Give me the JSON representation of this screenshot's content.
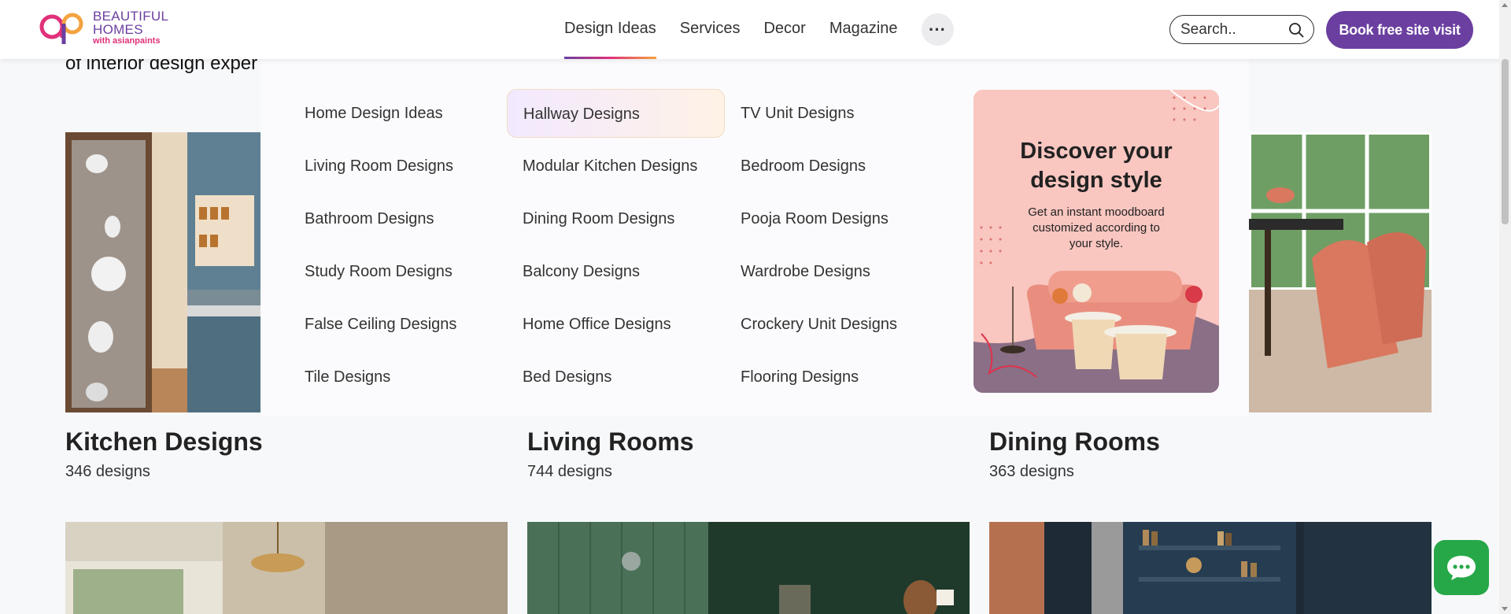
{
  "header": {
    "logo_line1": "BEAUTIFUL",
    "logo_line2": "HOMES",
    "logo_line3": "with asianpaints",
    "nav": [
      "Design Ideas",
      "Services",
      "Decor",
      "Magazine"
    ],
    "more_label": "···",
    "search_placeholder": "Search..",
    "book_label": "Book free site visit"
  },
  "page": {
    "intro_text": "of interior design exper",
    "cards": [
      {
        "title": "Kitchen Designs",
        "count": "346 designs"
      },
      {
        "title": "Living Rooms",
        "count": "744 designs"
      },
      {
        "title": "Dining Rooms",
        "count": "363 designs"
      }
    ]
  },
  "dropdown": {
    "columns": [
      [
        "Home Design Ideas",
        "Living Room Designs",
        "Bathroom Designs",
        "Study Room Designs",
        "False Ceiling Designs",
        "Tile Designs"
      ],
      [
        "Hallway Designs",
        "Modular Kitchen Designs",
        "Dining Room Designs",
        "Balcony Designs",
        "Home Office Designs",
        "Bed Designs"
      ],
      [
        "TV Unit Designs",
        "Bedroom Designs",
        "Pooja Room Designs",
        "Wardrobe Designs",
        "Crockery Unit Designs",
        "Flooring Designs"
      ]
    ],
    "highlighted": "Hallway Designs",
    "promo": {
      "title": "Discover your design style",
      "subtitle": "Get an instant moodboard customized according to your style."
    }
  },
  "colors": {
    "brand_purple": "#6b3fa0",
    "brand_pink": "#e0317a",
    "chat_green": "#27a848"
  },
  "icons": [
    "search-icon",
    "chat-icon",
    "more-dots-icon"
  ]
}
